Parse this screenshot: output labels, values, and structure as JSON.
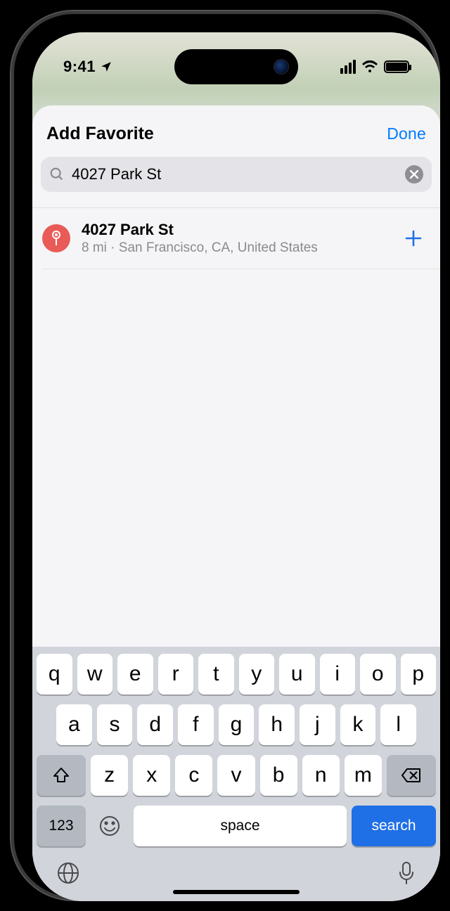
{
  "status": {
    "time": "9:41"
  },
  "sheet": {
    "title": "Add Favorite",
    "done_label": "Done"
  },
  "search": {
    "value": "4027 Park St"
  },
  "result": {
    "title": "4027 Park St",
    "subtitle": "8 mi · San Francisco, CA, United States"
  },
  "keyboard": {
    "row1": [
      "q",
      "w",
      "e",
      "r",
      "t",
      "y",
      "u",
      "i",
      "o",
      "p"
    ],
    "row2": [
      "a",
      "s",
      "d",
      "f",
      "g",
      "h",
      "j",
      "k",
      "l"
    ],
    "row3": [
      "z",
      "x",
      "c",
      "v",
      "b",
      "n",
      "m"
    ],
    "num_label": "123",
    "space_label": "space",
    "search_label": "search"
  }
}
